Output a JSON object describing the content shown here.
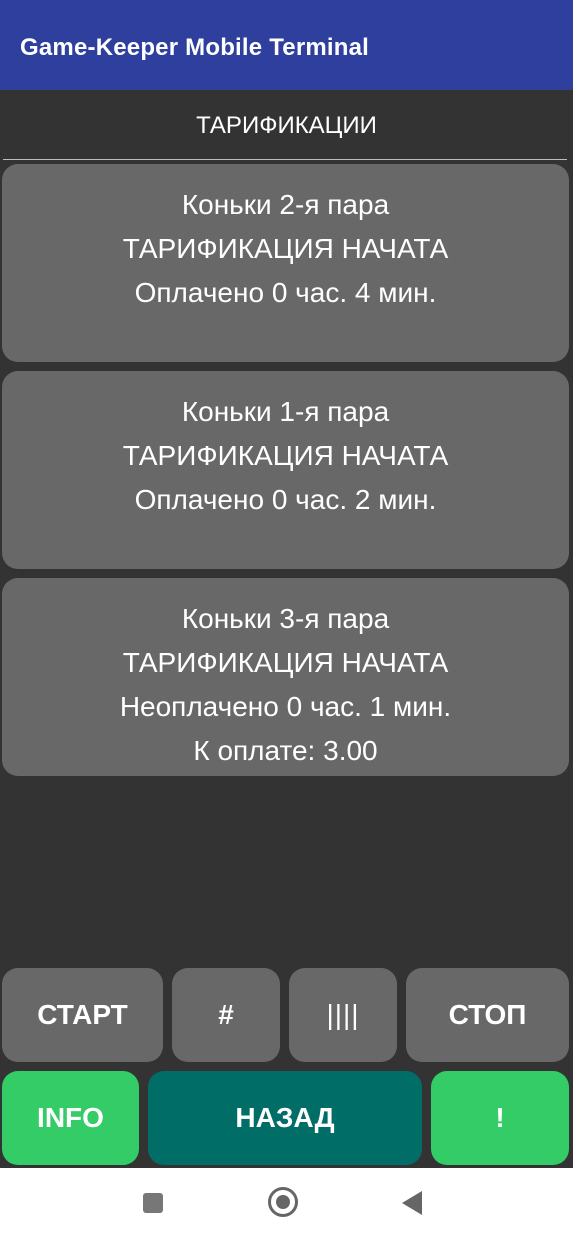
{
  "appbar": {
    "title": "Game-Keeper Mobile Terminal"
  },
  "section": {
    "title": "ТАРИФИКАЦИИ"
  },
  "cards": [
    {
      "line1": "Коньки 2-я пара",
      "line2": "ТАРИФИКАЦИЯ НАЧАТА",
      "line3": "Оплачено 0 час. 4 мин.",
      "line4": ""
    },
    {
      "line1": "Коньки 1-я пара",
      "line2": "ТАРИФИКАЦИЯ НАЧАТА",
      "line3": "Оплачено 0 час. 2 мин.",
      "line4": ""
    },
    {
      "line1": "Коньки 3-я пара",
      "line2": "ТАРИФИКАЦИЯ НАЧАТА",
      "line3": "Неоплачено 0 час. 1 мин.",
      "line4": "К оплате: 3.00"
    }
  ],
  "buttons": {
    "start": "СТАРТ",
    "hash": "#",
    "barcode": "||||",
    "stop": "СТОП",
    "info": "INFO",
    "back": "НАЗАД",
    "alert": "!"
  },
  "colors": {
    "appbar": "#2f3f9e",
    "background": "#333333",
    "card": "#686868",
    "green": "#33cc66",
    "teal": "#006e66"
  },
  "icons": {
    "nav_recents": "square-icon",
    "nav_home": "circle-icon",
    "nav_back": "triangle-back-icon"
  }
}
